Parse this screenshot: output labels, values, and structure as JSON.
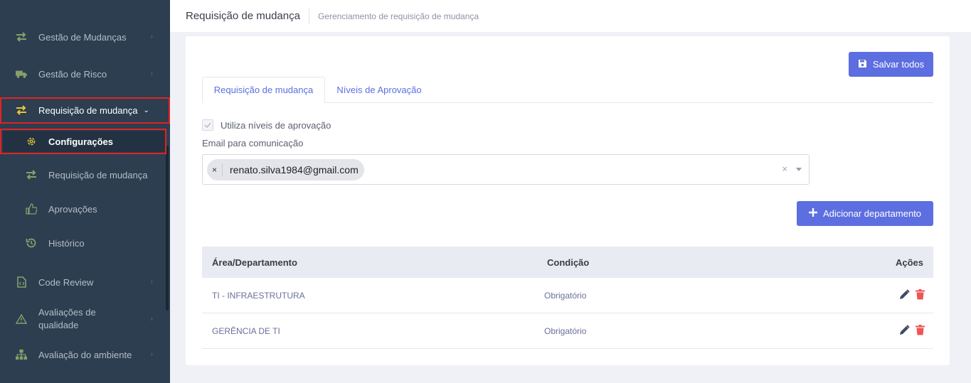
{
  "sidebar": {
    "items": [
      {
        "label": "Gestão de Mudanças",
        "icon": "arrows-exchange-icon"
      },
      {
        "label": "Gestão de Risco",
        "icon": "truck-icon"
      },
      {
        "label": "Requisição de mudança",
        "icon": "arrows-exchange-icon",
        "expanded": true
      },
      {
        "label": "Code Review",
        "icon": "code-file-icon"
      },
      {
        "label": "Avaliações de qualidade",
        "icon": "warning-triangle-icon"
      },
      {
        "label": "Avaliação do ambiente",
        "icon": "sitemap-icon"
      }
    ],
    "submenu": [
      {
        "label": "Configurações",
        "icon": "gear-icon",
        "active": true
      },
      {
        "label": "Requisição de mudança",
        "icon": "arrows-exchange-icon"
      },
      {
        "label": "Aprovações",
        "icon": "thumbs-up-icon"
      },
      {
        "label": "Histórico",
        "icon": "history-icon"
      }
    ]
  },
  "header": {
    "title": "Requisição de mudança",
    "subtitle": "Gerenciamento de requisição de mudança"
  },
  "toolbar": {
    "save_all_label": "Salvar todos",
    "add_department_label": "Adicionar departamento"
  },
  "tabs": [
    {
      "label": "Requisição de mudança",
      "active": true
    },
    {
      "label": "Níveis de Aprovação",
      "active": false
    }
  ],
  "form": {
    "use_levels_label": "Utiliza níveis de aprovação",
    "use_levels_checked": true,
    "email_label": "Email para comunicação",
    "email_chips": [
      "renato.silva1984@gmail.com"
    ],
    "chip_remove": "×",
    "clear_symbol": "×"
  },
  "table": {
    "columns": [
      "Área/Departamento",
      "Condição",
      "Ações"
    ],
    "rows": [
      {
        "area": "TI - INFRAESTRUTURA",
        "condition": "Obrigatório"
      },
      {
        "area": "GERÊNCIA DE TI",
        "condition": "Obrigatório"
      }
    ]
  },
  "colors": {
    "sidebar_bg": "#2c3e50",
    "accent": "#5d6ee0",
    "highlight_border": "#e02424",
    "delete_icon": "#f05454",
    "edit_icon": "#3f4a66",
    "active_icon": "#e9c33a"
  }
}
